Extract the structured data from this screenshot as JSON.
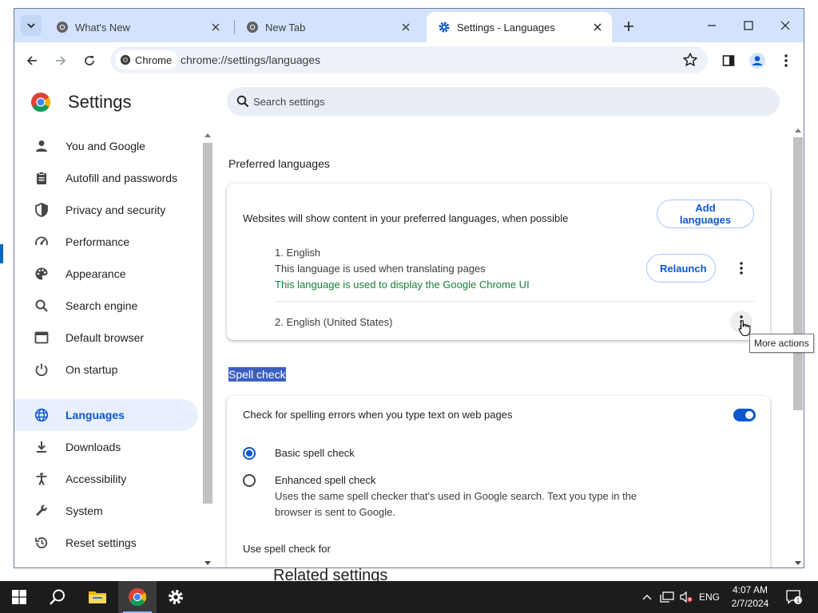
{
  "browser": {
    "tabs": [
      {
        "title": "What's New",
        "active": false
      },
      {
        "title": "New Tab",
        "active": false
      },
      {
        "title": "Settings - Languages",
        "active": true
      }
    ],
    "chip_label": "Chrome",
    "url": "chrome://settings/languages"
  },
  "settings": {
    "title": "Settings",
    "search_placeholder": "Search settings",
    "nav": [
      {
        "label": "You and Google",
        "icon": "person-icon"
      },
      {
        "label": "Autofill and passwords",
        "icon": "clipboard-icon"
      },
      {
        "label": "Privacy and security",
        "icon": "shield-icon"
      },
      {
        "label": "Performance",
        "icon": "speedometer-icon"
      },
      {
        "label": "Appearance",
        "icon": "palette-icon"
      },
      {
        "label": "Search engine",
        "icon": "search-icon"
      },
      {
        "label": "Default browser",
        "icon": "browser-window-icon"
      },
      {
        "label": "On startup",
        "icon": "power-icon"
      },
      {
        "label": "Languages",
        "icon": "globe-icon",
        "selected": true
      },
      {
        "label": "Downloads",
        "icon": "download-icon"
      },
      {
        "label": "Accessibility",
        "icon": "accessibility-icon"
      },
      {
        "label": "System",
        "icon": "wrench-icon"
      },
      {
        "label": "Reset settings",
        "icon": "reset-history-icon"
      }
    ]
  },
  "languages": {
    "section_title": "Preferred languages",
    "description": "Websites will show content in your preferred languages, when possible",
    "add_button": "Add languages",
    "items": [
      {
        "name": "1. English",
        "note": "This language is used when translating pages",
        "note_ui": "This language is used to display the Google Chrome UI",
        "action": "Relaunch"
      },
      {
        "name": "2. English (United States)"
      }
    ]
  },
  "spellcheck": {
    "section_title": "Spell check",
    "toggle_label": "Check for spelling errors when you type text on web pages",
    "toggle_on": true,
    "basic_label": "Basic spell check",
    "enhanced_label": "Enhanced spell check",
    "enhanced_desc_1": "Uses the same spell checker that's used in Google search. Text you type in the",
    "enhanced_desc_2": "browser is sent to Google.",
    "selected_option": "basic",
    "use_for_label": "Use spell check for"
  },
  "related_settings_peek": "Related settings",
  "tooltip": "More actions",
  "taskbar": {
    "language": "ENG",
    "time": "4:07 AM",
    "date": "2/7/2024",
    "notification_count": "1"
  },
  "colors": {
    "accent": "#0b57d0",
    "tabstrip": "#d3e3fd",
    "selected_nav_bg": "#e8f0fe",
    "green_note": "#188038",
    "taskbar": "#1c1c1c"
  }
}
